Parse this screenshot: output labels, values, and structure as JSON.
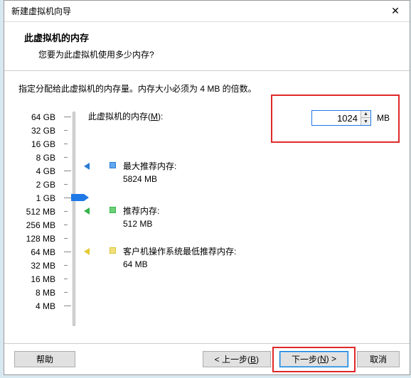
{
  "window": {
    "title": "新建虚拟机向导",
    "close_glyph": "✕"
  },
  "header": {
    "title": "此虚拟机的内存",
    "subtitle": "您要为此虚拟机使用多少内存?"
  },
  "instruction": "指定分配给此虚拟机的内存量。内存大小必须为 4 MB 的倍数。",
  "memory": {
    "label_prefix": "此虚拟机的内存(",
    "label_hotkey": "M",
    "label_suffix": "):",
    "value": "1024",
    "unit": "MB"
  },
  "scale": [
    {
      "label": "64 GB",
      "major": true
    },
    {
      "label": "32 GB",
      "major": false
    },
    {
      "label": "16 GB",
      "major": false
    },
    {
      "label": "8 GB",
      "major": false
    },
    {
      "label": "4 GB",
      "major": true
    },
    {
      "label": "2 GB",
      "major": false
    },
    {
      "label": "1 GB",
      "major": true
    },
    {
      "label": "512 MB",
      "major": false
    },
    {
      "label": "256 MB",
      "major": false
    },
    {
      "label": "128 MB",
      "major": false
    },
    {
      "label": "64 MB",
      "major": true
    },
    {
      "label": "32 MB",
      "major": false
    },
    {
      "label": "16 MB",
      "major": false
    },
    {
      "label": "8 MB",
      "major": false
    },
    {
      "label": "4 MB",
      "major": true
    }
  ],
  "markers": {
    "max": {
      "label": "最大推荐内存:",
      "value": "5824 MB",
      "tick_index": 3.7
    },
    "rec": {
      "label": "推荐内存:",
      "value": "512 MB",
      "tick_index": 7
    },
    "min": {
      "label": "客户机操作系统最低推荐内存:",
      "value": "64 MB",
      "tick_index": 10
    }
  },
  "slider": {
    "tick_index": 6
  },
  "footer": {
    "help": "帮助",
    "back_prefix": "< 上一步(",
    "back_hotkey": "B",
    "back_suffix": ")",
    "next_prefix": "下一步(",
    "next_hotkey": "N",
    "next_suffix": ") >",
    "cancel": "取消"
  }
}
